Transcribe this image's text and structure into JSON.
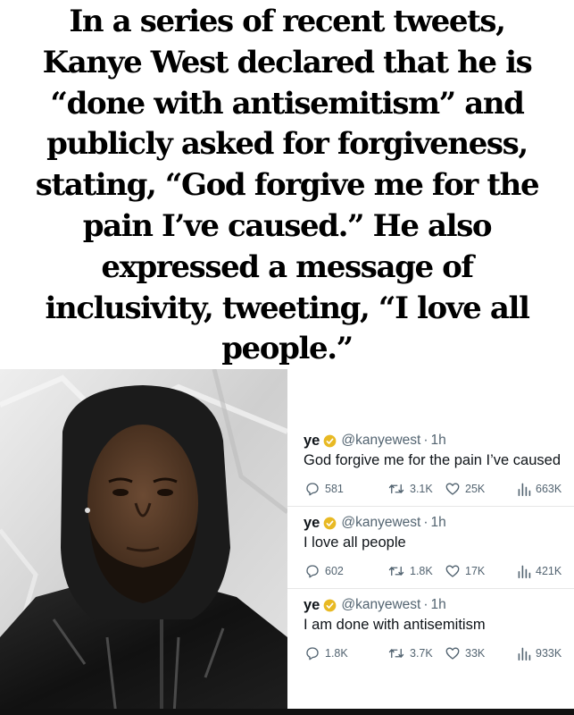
{
  "headline": {
    "lines": [
      "In a series of recent tweets,",
      "Kanye West declared that he is",
      "“done with antisemitism” and",
      "publicly asked for forgiveness,",
      "stating, “God forgive me for the",
      "pain I’ve caused.” He also",
      "expressed a message of",
      "inclusivity, tweeting, “I love all",
      "people.”"
    ]
  },
  "photo": {
    "icon": "portrait-photo"
  },
  "tweets": [
    {
      "name": "ye",
      "handle": "@kanyewest",
      "separator": "·",
      "time": "1h",
      "text": "God forgive me for the pain I’ve caused",
      "replies": "581",
      "retweets": "3.1K",
      "likes": "25K",
      "views": "663K"
    },
    {
      "name": "ye",
      "handle": "@kanyewest",
      "separator": "·",
      "time": "1h",
      "text": "I love all people",
      "replies": "602",
      "retweets": "1.8K",
      "likes": "17K",
      "views": "421K"
    },
    {
      "name": "ye",
      "handle": "@kanyewest",
      "separator": "·",
      "time": "1h",
      "text": "I am done with antisemitism",
      "replies": "1.8K",
      "retweets": "3.7K",
      "likes": "33K",
      "views": "933K"
    }
  ],
  "colors": {
    "verified_badge": "#e8b923",
    "muted_text": "#536471",
    "text": "#0f1419"
  }
}
